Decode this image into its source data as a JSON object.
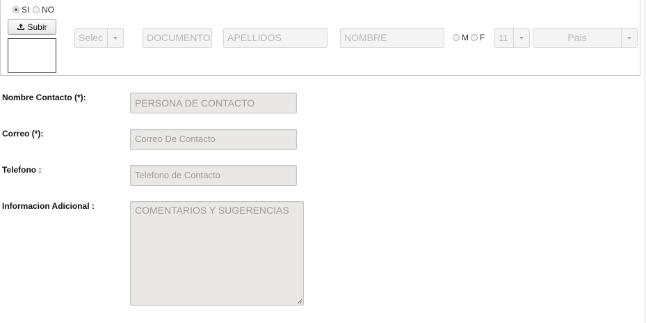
{
  "top_panel": {
    "radio_si": "SI",
    "radio_no": "NO",
    "upload_button": "Subir",
    "doc_type_select": "Selec",
    "documento_placeholder": "DOCUMENTO",
    "apellidos_placeholder": "APELLIDOS",
    "nombre_placeholder": "NOMBRE",
    "gender_m": "M",
    "gender_f": "F",
    "number_select": "11",
    "country_select": "Pais"
  },
  "form": {
    "nombre_label": "Nombre Contacto (*):",
    "nombre_placeholder": "PERSONA DE CONTACTO",
    "correo_label": "Correo (*):",
    "correo_placeholder": "Correo De Contacto",
    "telefono_label": "Telefono :",
    "telefono_placeholder": "Telefono de Contacto",
    "info_label": "Informacion Adicional :",
    "info_placeholder": "COMENTARIOS Y SUGERENCIAS"
  }
}
